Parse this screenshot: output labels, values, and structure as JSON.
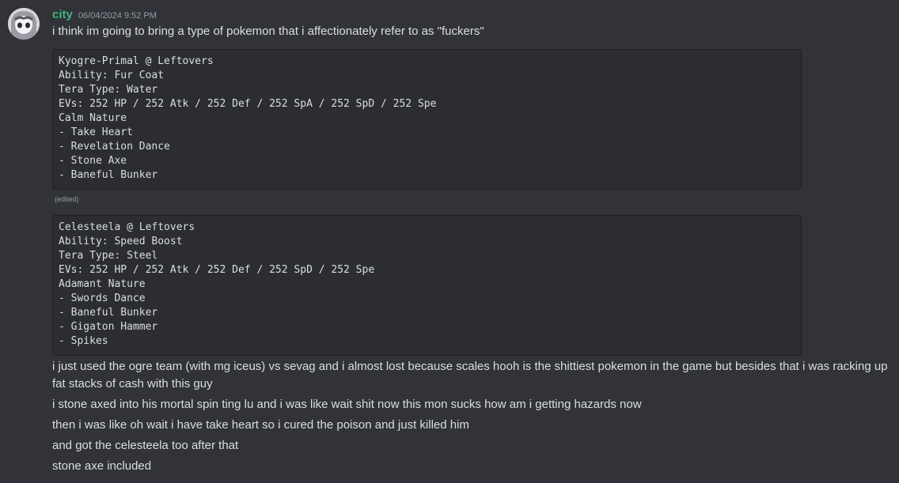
{
  "author": {
    "username": "city",
    "timestamp": "06/04/2024 9:52 PM"
  },
  "message_1": "i think im going to bring a type of pokemon that i affectionately refer to as \"fuckers\"",
  "code_block_1": [
    "Kyogre-Primal @ Leftovers",
    "Ability: Fur Coat",
    "Tera Type: Water",
    "EVs: 252 HP / 252 Atk / 252 Def / 252 SpA / 252 SpD / 252 Spe",
    "Calm Nature",
    "- Take Heart",
    "- Revelation Dance",
    "- Stone Axe",
    "- Baneful Bunker"
  ],
  "edited_label": "(edited)",
  "code_block_2": [
    "Celesteela @ Leftovers",
    "Ability: Speed Boost",
    "Tera Type: Steel",
    "EVs: 252 HP / 252 Atk / 252 Def / 252 SpD / 252 Spe",
    "Adamant Nature",
    "- Swords Dance",
    "- Baneful Bunker",
    "- Gigaton Hammer",
    "- Spikes"
  ],
  "message_2": "i just used the ogre team (with mg iceus) vs sevag and i almost lost because scales hooh is the shittiest pokemon in the game but besides that i was racking up fat stacks of cash with this guy",
  "message_3": "i stone axed into his mortal spin ting lu and i was like wait shit now this mon sucks how am i getting hazards now",
  "message_4": "then i was like oh wait i have take heart so i cured the poison and just killed him",
  "message_5": "and got the celesteela too after that",
  "message_6": "stone axe included",
  "colors": {
    "background": "#313338",
    "username": "#43b581",
    "code_background": "#2b2d31"
  },
  "icons": {
    "avatar": "anime-character-avatar"
  }
}
